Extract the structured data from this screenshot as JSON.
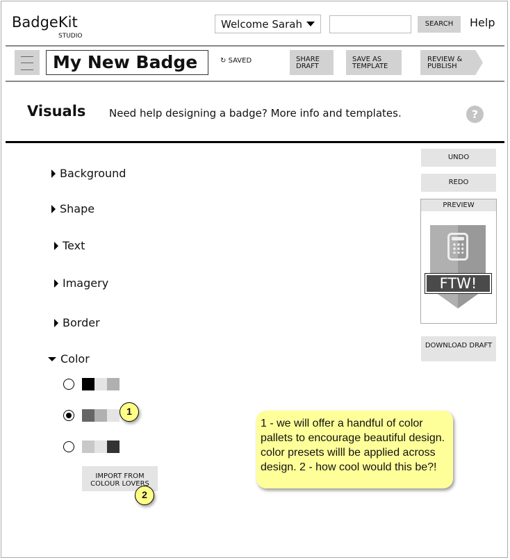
{
  "header": {
    "logo": "BadgeKit",
    "logo_sub": "STUDIO",
    "user_menu": "Welcome Sarah",
    "search_value": "",
    "search_button": "SEARCH",
    "help": "Help"
  },
  "toolbar": {
    "badge_name": "My New Badge",
    "saved": "SAVED",
    "share": "SHARE DRAFT",
    "save_template": "SAVE AS TEMPLATE",
    "review": "REVIEW & PUBLISH"
  },
  "section": {
    "title": "Visuals",
    "help_prefix": "Need help designing a badge? ",
    "more_info": "More info",
    "and": " and ",
    "templates": "templates",
    "period": ".",
    "help_icon": "?"
  },
  "accordion": [
    {
      "label": "Background",
      "expanded": false
    },
    {
      "label": "Shape",
      "expanded": false
    },
    {
      "label": "Text",
      "expanded": false
    },
    {
      "label": "Imagery",
      "expanded": false
    },
    {
      "label": "Border",
      "expanded": false
    },
    {
      "label": "Color",
      "expanded": true
    }
  ],
  "palettes": [
    {
      "selected": false,
      "colors": [
        "#000000",
        "#e4e4e4",
        "#b0b0b0"
      ]
    },
    {
      "selected": true,
      "colors": [
        "#666666",
        "#b0b0b0",
        "#e4e4e4"
      ]
    },
    {
      "selected": false,
      "colors": [
        "#c8c8c8",
        "#e4e4e4",
        "#333333"
      ]
    }
  ],
  "import_button": "IMPORT FROM COLOUR LOVERS",
  "markers": [
    "1",
    "2"
  ],
  "note": "1 - we will offer a handful of color pallets to encourage beautiful design. color presets willl be applied across design. 2 - how cool would this be?!",
  "side": {
    "undo": "UNDO",
    "redo": "REDO",
    "preview": "PREVIEW",
    "badge_text": "FTW!",
    "download": "DOWNLOAD DRAFT"
  }
}
